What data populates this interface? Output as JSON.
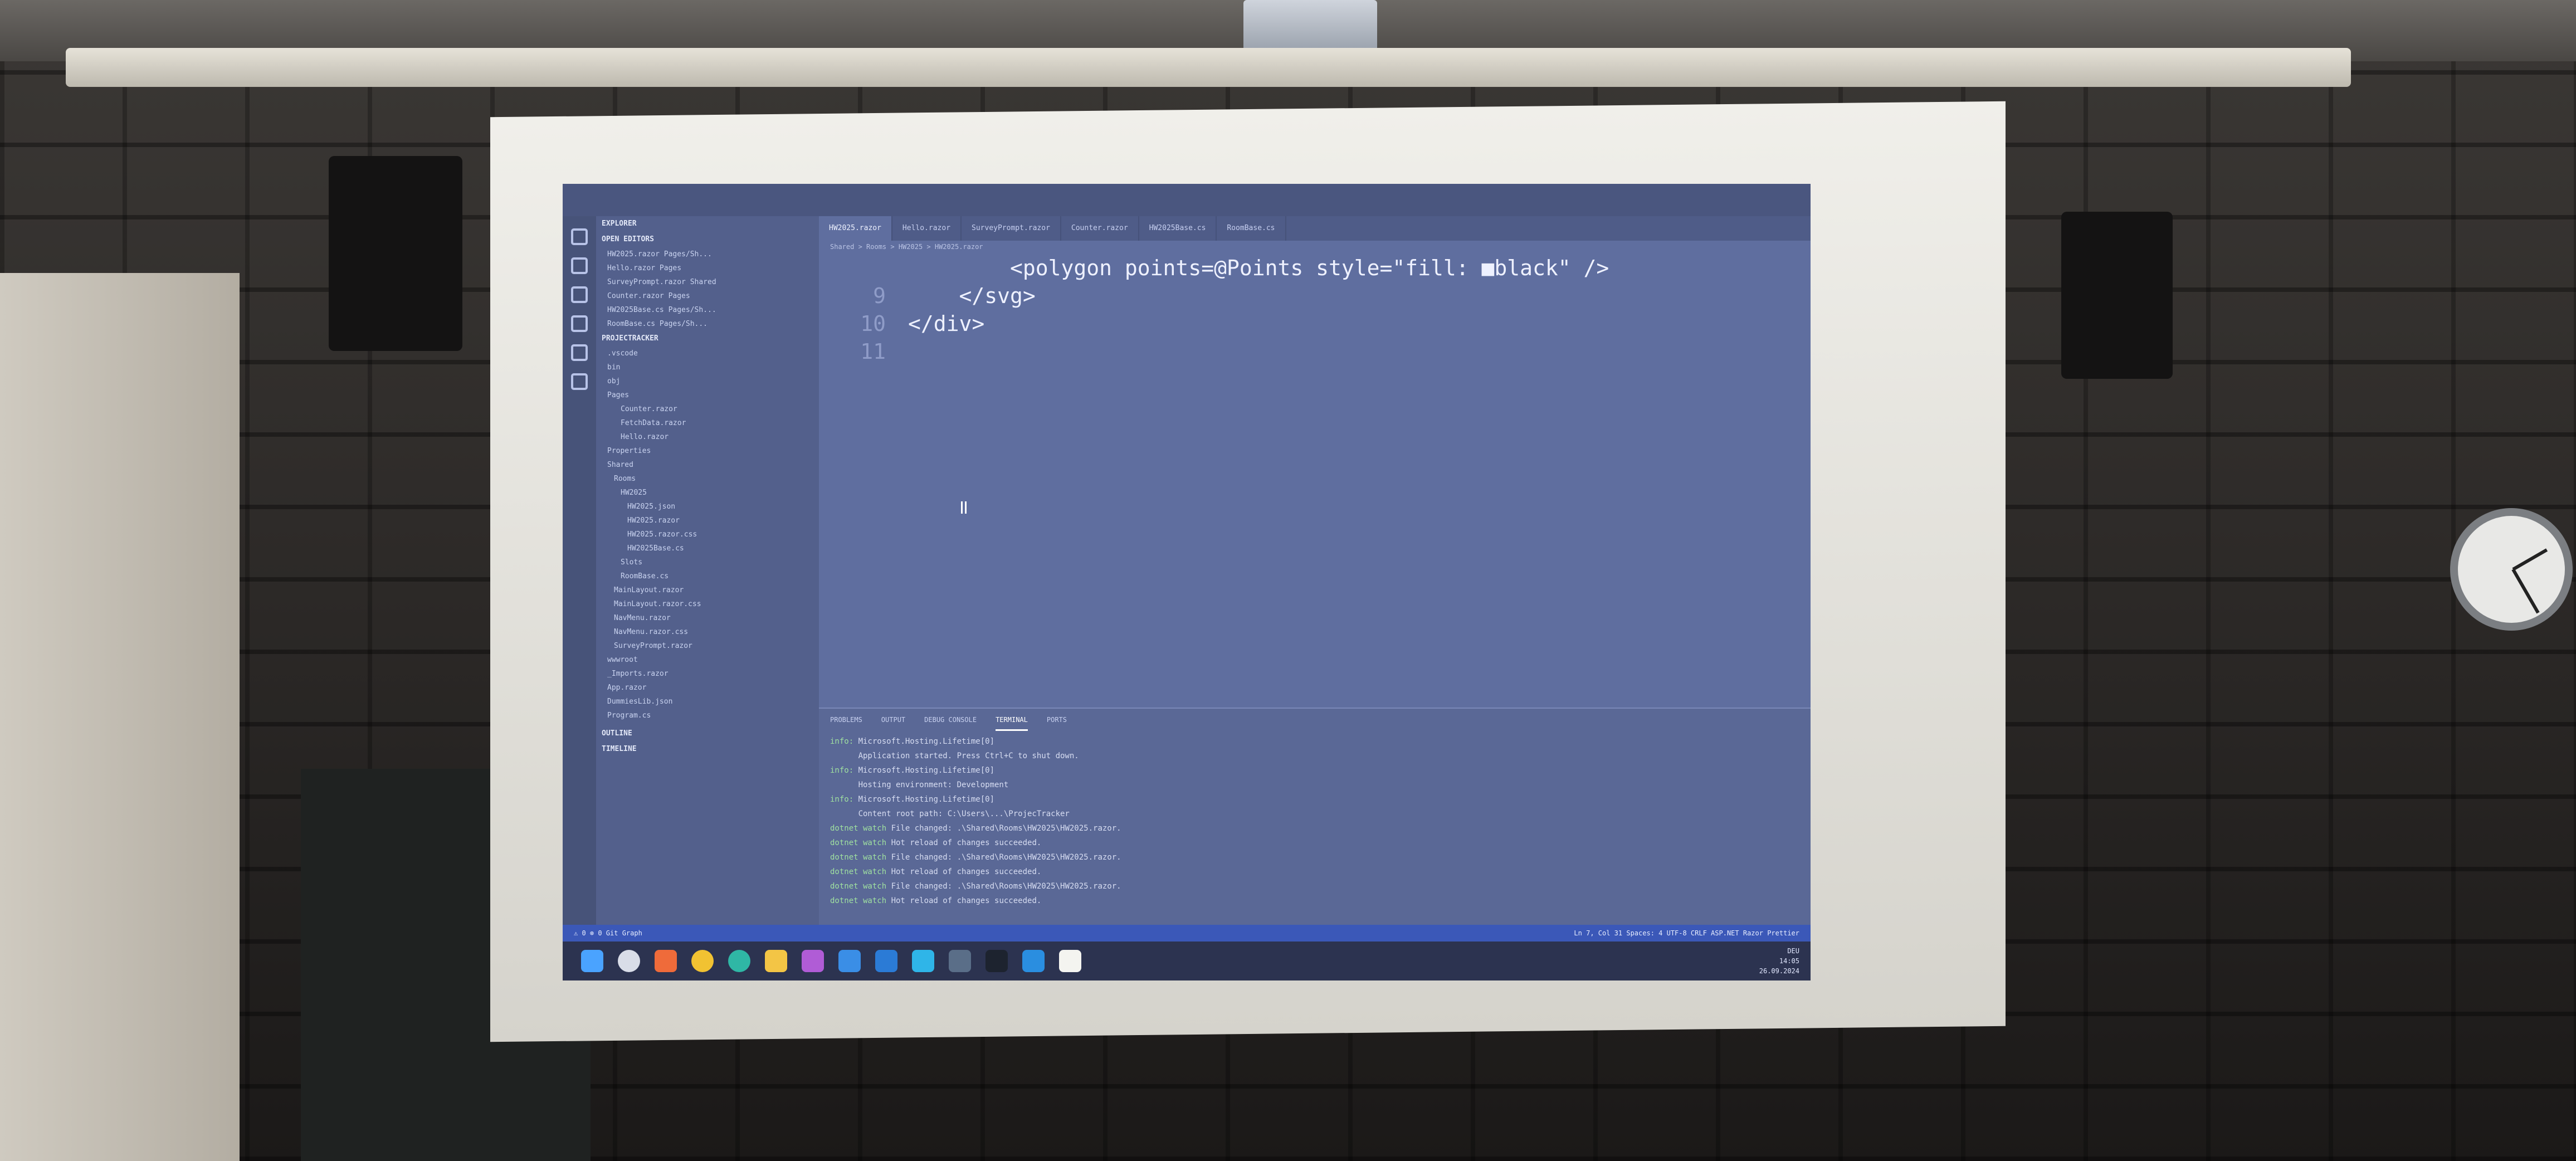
{
  "scene": {
    "description_colors": {
      "wall": "#2e2b29",
      "screen": "#e8e6df",
      "editor_bg": "#5f6e9f",
      "statusbar": "#3b58b8"
    }
  },
  "vscode": {
    "sidebar": {
      "explorer_title": "EXPLORER",
      "open_editors_label": "OPEN EDITORS",
      "project_label": "PROJECTRACKER",
      "items": [
        "HW2025.razor Pages/Sh...",
        "Hello.razor Pages",
        "SurveyPrompt.razor Shared",
        "Counter.razor Pages",
        "HW2025Base.cs Pages/Sh...",
        "RoomBase.cs Pages/Sh...",
        ".vscode",
        "bin",
        "obj",
        "Pages",
        "Counter.razor",
        "FetchData.razor",
        "Hello.razor",
        "Properties",
        "Shared",
        "Rooms",
        "HW2025",
        "HW2025.json",
        "HW2025.razor",
        "HW2025.razor.css",
        "HW2025Base.cs",
        "Slots",
        "RoomBase.cs",
        "MainLayout.razor",
        "MainLayout.razor.css",
        "NavMenu.razor",
        "NavMenu.razor.css",
        "SurveyPrompt.razor",
        "wwwroot",
        "_Imports.razor",
        "App.razor",
        "DummiesLib.json",
        "Program.cs"
      ],
      "outline_label": "OUTLINE",
      "timeline_label": "TIMELINE"
    },
    "tabs": [
      {
        "label": "HW2025.razor",
        "active": true
      },
      {
        "label": "Hello.razor",
        "active": false
      },
      {
        "label": "SurveyPrompt.razor",
        "active": false
      },
      {
        "label": "Counter.razor",
        "active": false
      },
      {
        "label": "HW2025Base.cs",
        "active": false
      },
      {
        "label": "RoomBase.cs",
        "active": false
      }
    ],
    "breadcrumb": "Shared > Rooms > HW2025 > HW2025.razor",
    "editor_lines": [
      {
        "num": "",
        "text": "        <polygon points=@Points style=\"fill: ■black\" />"
      },
      {
        "num": "9",
        "text": "    </svg>"
      },
      {
        "num": "10",
        "text": "</div>"
      },
      {
        "num": "11",
        "text": ""
      }
    ],
    "panel_tabs": [
      "PROBLEMS",
      "OUTPUT",
      "DEBUG CONSOLE",
      "TERMINAL",
      "PORTS"
    ],
    "active_panel_tab": "TERMINAL",
    "terminal_lines": [
      {
        "level": "info:",
        "text": "Microsoft.Hosting.Lifetime[0]"
      },
      {
        "level": "",
        "text": "      Application started. Press Ctrl+C to shut down."
      },
      {
        "level": "info:",
        "text": "Microsoft.Hosting.Lifetime[0]"
      },
      {
        "level": "",
        "text": "      Hosting environment: Development"
      },
      {
        "level": "info:",
        "text": "Microsoft.Hosting.Lifetime[0]"
      },
      {
        "level": "",
        "text": "      Content root path: C:\\Users\\...\\ProjecTracker"
      },
      {
        "level": "dotnet watch",
        "text": "File changed: .\\Shared\\Rooms\\HW2025\\HW2025.razor."
      },
      {
        "level": "dotnet watch",
        "text": "Hot reload of changes succeeded."
      },
      {
        "level": "dotnet watch",
        "text": "File changed: .\\Shared\\Rooms\\HW2025\\HW2025.razor."
      },
      {
        "level": "dotnet watch",
        "text": "Hot reload of changes succeeded."
      },
      {
        "level": "dotnet watch",
        "text": "File changed: .\\Shared\\Rooms\\HW2025\\HW2025.razor."
      },
      {
        "level": "dotnet watch",
        "text": "Hot reload of changes succeeded."
      }
    ],
    "statusbar_left": "⚠ 0  ⊗ 0   Git Graph",
    "statusbar_right": "Ln 7, Col 31   Spaces: 4   UTF-8   CRLF   ASP.NET Razor   Prettier"
  },
  "taskbar": {
    "time": "14:05",
    "date": "26.09.2024",
    "lang": "DEU"
  }
}
